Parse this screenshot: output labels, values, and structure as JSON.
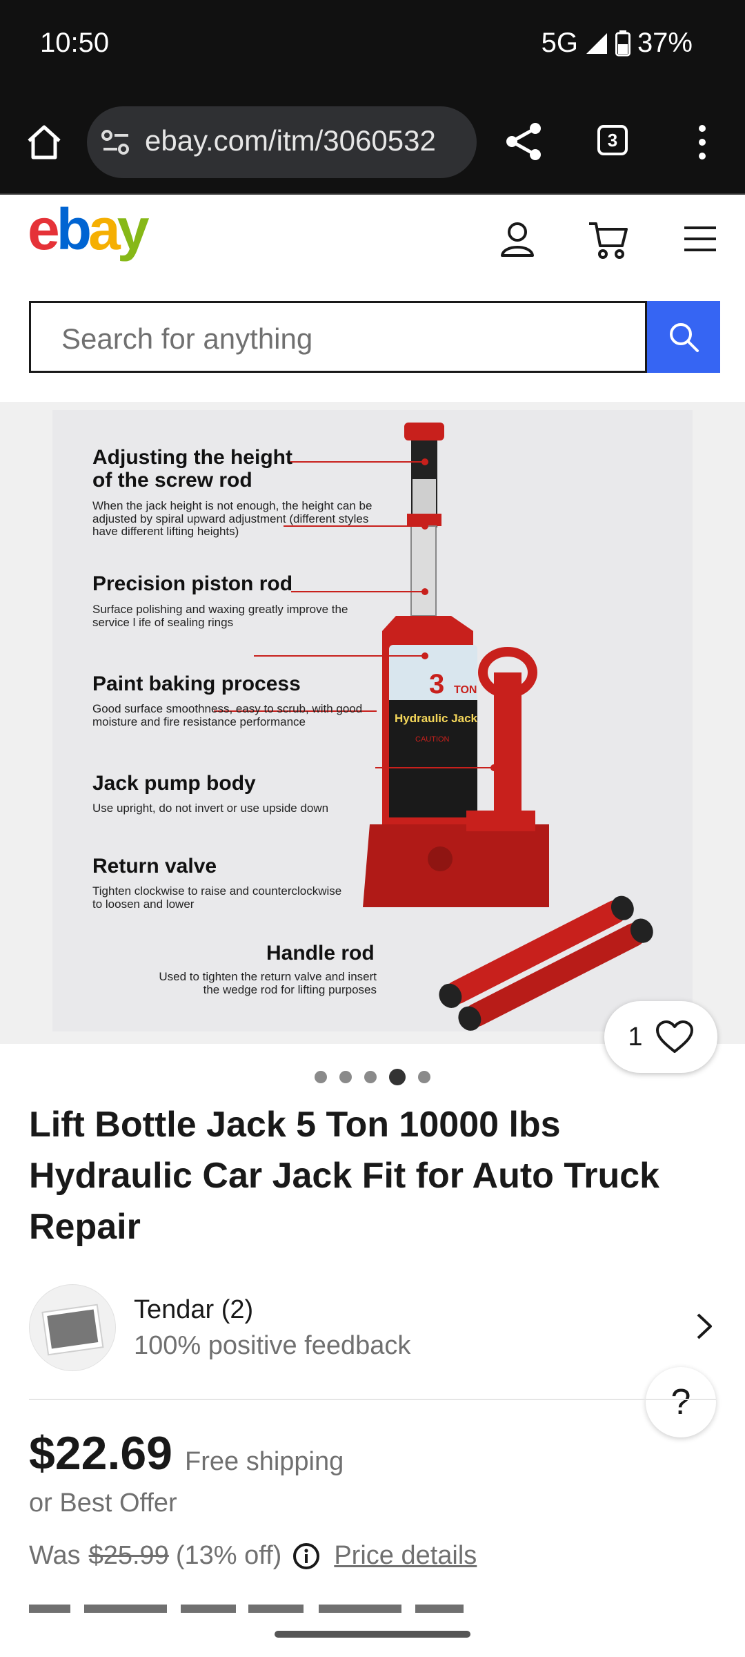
{
  "status_bar": {
    "time": "10:50",
    "network": "5G",
    "battery": "37%"
  },
  "browser": {
    "url": "ebay.com/itm/3060532",
    "tab_count": "3"
  },
  "header": {
    "logo": {
      "e": "e",
      "b": "b",
      "a": "a",
      "y": "y"
    },
    "logo_colors": [
      "#e53238",
      "#0064d2",
      "#f5af02",
      "#86b817"
    ]
  },
  "search": {
    "placeholder": "Search for anything"
  },
  "gallery": {
    "callouts": [
      {
        "title": "Adjusting the height\nof the screw rod",
        "desc": "When the jack height is not enough, the height can be adjusted by spiral upward adjustment (different styles have different lifting heights)"
      },
      {
        "title": "Precision piston rod",
        "desc": "Surface polishing and waxing greatly improve the service l ife of sealing rings"
      },
      {
        "title": "Paint baking process",
        "desc": "Good surface smoothness, easy to scrub, with good moisture and fire resistance performance"
      },
      {
        "title": "Jack pump body",
        "desc": "Use upright, do not invert or use upside down"
      },
      {
        "title": "Return valve",
        "desc": "Tighten clockwise to raise and counterclockwise to loosen and lower"
      },
      {
        "title": "Handle rod",
        "desc": "Used to tighten the return valve and insert the wedge rod for lifting purposes"
      }
    ],
    "label": {
      "tonnage": "3",
      "ton": "TON",
      "name": "Hydraulic Jack",
      "caution": "CAUTION"
    },
    "watch_count": "1",
    "dots_total": 5,
    "dots_active": 4
  },
  "product": {
    "title": "Lift Bottle Jack 5 Ton 10000 lbs Hydraulic Car Jack Fit for Auto Truck Repair",
    "seller_name": "Tendar (2)",
    "seller_feedback": "100% positive feedback",
    "price": "$22.69",
    "shipping": "Free shipping",
    "best_offer": "or Best Offer",
    "was_label": "Was",
    "was_price": "$25.99",
    "discount": "(13% off)",
    "price_details": "Price details",
    "help": "?"
  },
  "colors": {
    "accent": "#3665f3",
    "jack_red": "#c8201c"
  }
}
